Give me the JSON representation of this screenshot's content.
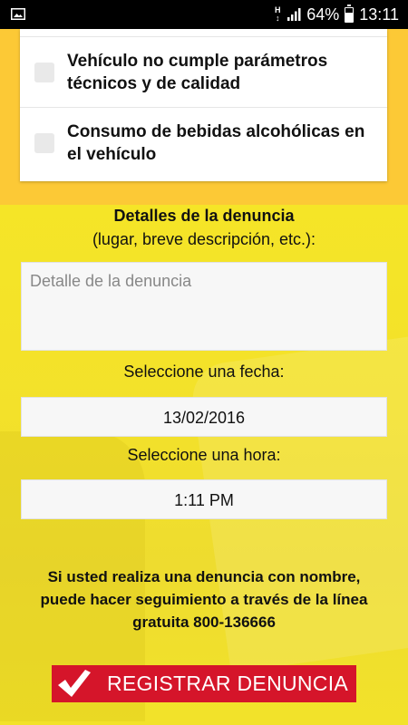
{
  "status_bar": {
    "battery": "64%",
    "time": "13:11",
    "network_letter": "H",
    "icons": [
      "picture-icon",
      "h-network-icon",
      "signal-icon",
      "battery-icon"
    ]
  },
  "options": [
    {
      "label": "Vehículo no cumple parámetros técnicos y de calidad",
      "checked": false
    },
    {
      "label": "Consumo de bebidas alcohólicas en el vehículo",
      "checked": false
    }
  ],
  "details": {
    "title": "Detalles de la denuncia",
    "subtitle": "(lugar, breve descripción, etc.):",
    "placeholder": "Detalle de la denuncia",
    "value": ""
  },
  "date": {
    "label": "Seleccione una fecha:",
    "value": "13/02/2016"
  },
  "time": {
    "label": "Seleccione una hora:",
    "value": "1:11 PM"
  },
  "info": {
    "line1": "Si usted realiza una denuncia con nombre,",
    "line2": "puede hacer seguimiento a través de la línea",
    "line3": "gratuita 800-136666"
  },
  "register_button": {
    "label": "REGISTRAR DENUNCIA"
  },
  "colors": {
    "top_band": "#fcc936",
    "yellow": "#f2e22e",
    "button": "#d5152a"
  }
}
